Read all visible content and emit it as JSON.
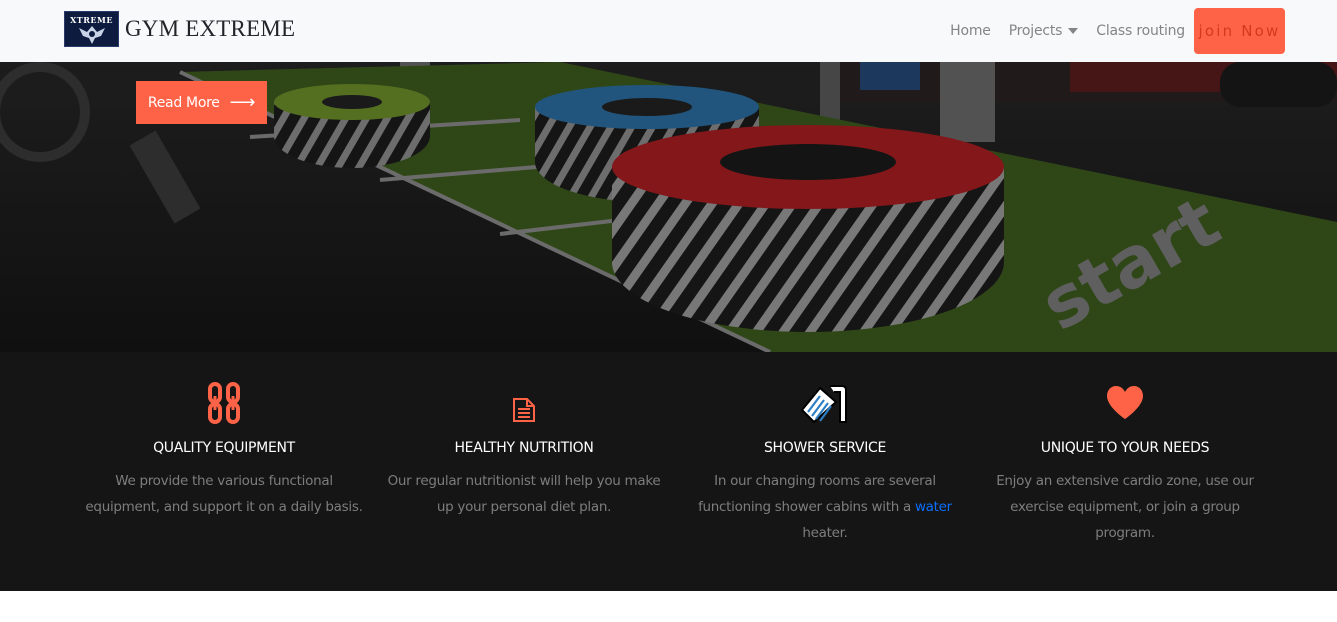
{
  "navbar": {
    "logo_text": "XTREME",
    "brand_name": "GYM EXTREME",
    "links": [
      {
        "label": "Home"
      },
      {
        "label": "Projects"
      },
      {
        "label": "Class routing"
      }
    ],
    "join_label": "join Now"
  },
  "hero": {
    "read_more_label": "Read More",
    "read_more_arrow": "⟶",
    "floor_text": "start"
  },
  "features": [
    {
      "icon": "chain-icon",
      "title": "QUALITY EQUIPMENT",
      "desc": "We provide the various functional equipment, and support it on a daily basis."
    },
    {
      "icon": "document-icon",
      "title": "HEALTHY NUTRITION",
      "desc": "Our regular nutritionist will help you make up your personal diet plan."
    },
    {
      "icon": "shower-icon",
      "title": "SHOWER SERVICE",
      "desc_before": "In our changing rooms are several functioning shower cabins with a",
      "desc_link": "water",
      "desc_after": "heater."
    },
    {
      "icon": "heart-icon",
      "title": "UNIQUE TO YOUR NEEDS",
      "desc": "Enjoy an extensive cardio zone, use our exercise equipment, or join a group program."
    }
  ],
  "colors": {
    "accent": "#ff6347",
    "dark": "#151515",
    "link": "#0d6efd"
  }
}
